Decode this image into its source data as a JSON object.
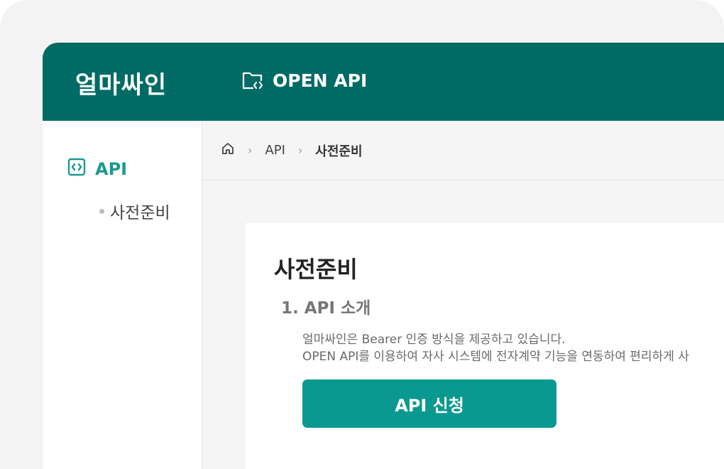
{
  "header": {
    "brand": "얼마싸인",
    "nav_label": "OPEN API",
    "nav_icon": "folder-code-icon"
  },
  "sidebar": {
    "main_label": "API",
    "main_icon": "code-icon",
    "sub_items": [
      {
        "label": "사전준비"
      }
    ]
  },
  "breadcrumb": {
    "home_icon": "home-icon",
    "items": [
      "API",
      "사전준비"
    ]
  },
  "main": {
    "title": "사전준비",
    "section_title": "1. API 소개",
    "description_lines": [
      "얼마싸인은 Bearer 인증 방식을 제공하고 있습니다.",
      "OPEN API를 이용하여 자사 시스템에 전자계약 기능을 연동하여 편리하게 사"
    ],
    "apply_button": "API 신청"
  },
  "colors": {
    "header_bg": "#006b64",
    "accent": "#1a9a90",
    "button_bg": "#0a9990"
  }
}
